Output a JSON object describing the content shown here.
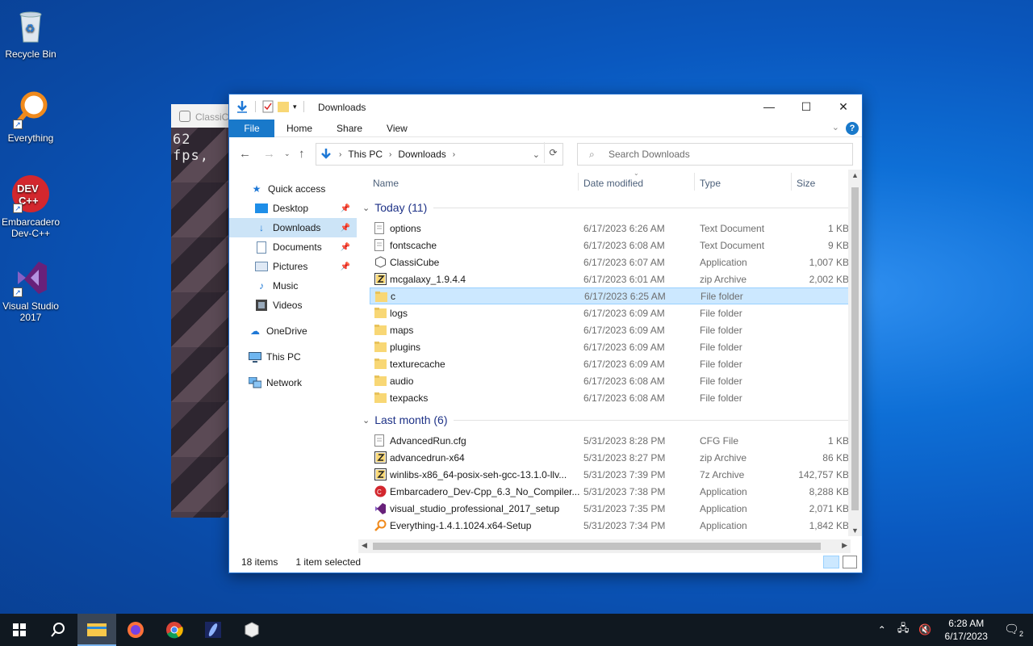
{
  "desktop": {
    "icons": [
      {
        "label": "Recycle Bin"
      },
      {
        "label": "Everything"
      },
      {
        "label": "Embarcadero Dev-C++"
      },
      {
        "label": "Visual Studio 2017"
      }
    ]
  },
  "classicube": {
    "title": "ClassiCu",
    "fps": "62 fps,"
  },
  "explorer": {
    "title": "Downloads",
    "ribbon": {
      "file": "File",
      "home": "Home",
      "share": "Share",
      "view": "View",
      "help": "?"
    },
    "address": {
      "segments": [
        "This PC",
        "Downloads"
      ]
    },
    "search": {
      "placeholder": "Search Downloads"
    },
    "nav": [
      {
        "label": "Quick access",
        "icon": "star-icon"
      },
      {
        "label": "Desktop",
        "icon": "desktop-icon",
        "pinned": true
      },
      {
        "label": "Downloads",
        "icon": "download-icon",
        "pinned": true,
        "selected": true
      },
      {
        "label": "Documents",
        "icon": "documents-icon",
        "pinned": true
      },
      {
        "label": "Pictures",
        "icon": "pictures-icon",
        "pinned": true
      },
      {
        "label": "Music",
        "icon": "music-icon"
      },
      {
        "label": "Videos",
        "icon": "videos-icon"
      },
      {
        "label": "OneDrive",
        "icon": "cloud-icon"
      },
      {
        "label": "This PC",
        "icon": "computer-icon"
      },
      {
        "label": "Network",
        "icon": "network-icon"
      }
    ],
    "columns": {
      "name": "Name",
      "date": "Date modified",
      "type": "Type",
      "size": "Size"
    },
    "groups": [
      {
        "label": "Today (11)",
        "files": [
          {
            "name": "options",
            "date": "6/17/2023 6:26 AM",
            "type": "Text Document",
            "size": "1 KB",
            "kind": "doc"
          },
          {
            "name": "fontscache",
            "date": "6/17/2023 6:08 AM",
            "type": "Text Document",
            "size": "9 KB",
            "kind": "doc"
          },
          {
            "name": "ClassiCube",
            "date": "6/17/2023 6:07 AM",
            "type": "Application",
            "size": "1,007 KB",
            "kind": "app"
          },
          {
            "name": "mcgalaxy_1.9.4.4",
            "date": "6/17/2023 6:01 AM",
            "type": "zip Archive",
            "size": "2,002 KB",
            "kind": "zip"
          },
          {
            "name": "c",
            "date": "6/17/2023 6:25 AM",
            "type": "File folder",
            "size": "",
            "kind": "folder",
            "selected": true
          },
          {
            "name": "logs",
            "date": "6/17/2023 6:09 AM",
            "type": "File folder",
            "size": "",
            "kind": "folder"
          },
          {
            "name": "maps",
            "date": "6/17/2023 6:09 AM",
            "type": "File folder",
            "size": "",
            "kind": "folder"
          },
          {
            "name": "plugins",
            "date": "6/17/2023 6:09 AM",
            "type": "File folder",
            "size": "",
            "kind": "folder"
          },
          {
            "name": "texturecache",
            "date": "6/17/2023 6:09 AM",
            "type": "File folder",
            "size": "",
            "kind": "folder"
          },
          {
            "name": "audio",
            "date": "6/17/2023 6:08 AM",
            "type": "File folder",
            "size": "",
            "kind": "folder"
          },
          {
            "name": "texpacks",
            "date": "6/17/2023 6:08 AM",
            "type": "File folder",
            "size": "",
            "kind": "folder"
          }
        ]
      },
      {
        "label": "Last month (6)",
        "files": [
          {
            "name": "AdvancedRun.cfg",
            "date": "5/31/2023 8:28 PM",
            "type": "CFG File",
            "size": "1 KB",
            "kind": "doc"
          },
          {
            "name": "advancedrun-x64",
            "date": "5/31/2023 8:27 PM",
            "type": "zip Archive",
            "size": "86 KB",
            "kind": "zip"
          },
          {
            "name": "winlibs-x86_64-posix-seh-gcc-13.1.0-llv...",
            "date": "5/31/2023 7:39 PM",
            "type": "7z Archive",
            "size": "142,757 KB",
            "kind": "zip"
          },
          {
            "name": "Embarcadero_Dev-Cpp_6.3_No_Compiler...",
            "date": "5/31/2023 7:38 PM",
            "type": "Application",
            "size": "8,288 KB",
            "kind": "devcpp"
          },
          {
            "name": "visual_studio_professional_2017_setup",
            "date": "5/31/2023 7:35 PM",
            "type": "Application",
            "size": "2,071 KB",
            "kind": "vs"
          },
          {
            "name": "Everything-1.4.1.1024.x64-Setup",
            "date": "5/31/2023 7:34 PM",
            "type": "Application",
            "size": "1,842 KB",
            "kind": "everything"
          }
        ]
      }
    ],
    "status": {
      "count": "18 items",
      "selected": "1 item selected"
    }
  },
  "taskbar": {
    "time": "6:28 AM",
    "date": "6/17/2023",
    "notifications": "2"
  },
  "colors": {
    "accent": "#1979ca",
    "selection": "#cce8ff",
    "taskbar": "#101820"
  }
}
